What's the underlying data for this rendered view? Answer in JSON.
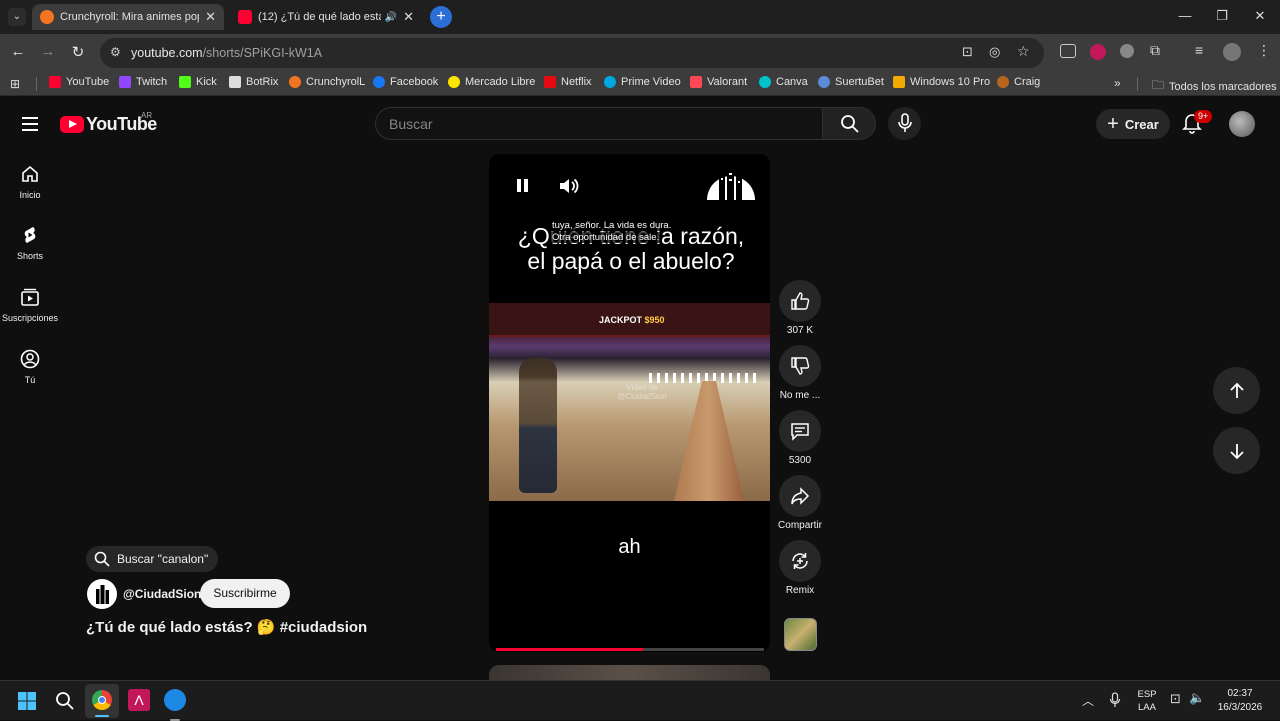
{
  "browser": {
    "tabs": [
      {
        "title": "Crunchyroll: Mira animes popul",
        "active": true
      },
      {
        "title": "(12) ¿Tú de qué lado estás?",
        "active": false
      }
    ],
    "url_host": "youtube.com",
    "url_path": "/shorts/SPiKGI-kW1A",
    "bookmarks": [
      "YouTube",
      "Twitch",
      "Kick",
      "BotRix",
      "CrunchyrolL",
      "Facebook",
      "Mercado Libre",
      "Netflix",
      "Prime Video",
      "Valorant",
      "Canva",
      "SuertuBet",
      "Windows 10 Pro",
      "Craig"
    ],
    "all_bookmarks": "Todos los marcadores",
    "bookmark_colors": [
      "#ff0033",
      "#9146ff",
      "#53fc18",
      "#dddddd",
      "#f47521",
      "#1877f2",
      "#ffe600",
      "#e50914",
      "#00a8e1",
      "#ff4655",
      "#00c4cc",
      "#5b8bd6",
      "#f2a900",
      "#b5651d"
    ]
  },
  "youtube": {
    "logo_text": "YouTube",
    "country": "AR",
    "search_placeholder": "Buscar",
    "create_label": "Crear",
    "notifications_badge": "9+",
    "sidebar": [
      {
        "label": "Inicio",
        "icon": "home-icon"
      },
      {
        "label": "Shorts",
        "icon": "shorts-icon"
      },
      {
        "label": "Suscripciones",
        "icon": "subscriptions-icon"
      },
      {
        "label": "Tú",
        "icon": "user-icon"
      }
    ],
    "short": {
      "overlay_question": "¿Quién tiene la razón, el papá o el abuelo?",
      "subtitle_line1": "tuya, señor. La vida es dura.",
      "subtitle_line2": "Otra oportunidad de sale.",
      "watermark": "Video de @CiudadSion",
      "caption": "ah",
      "progress": 0.55
    },
    "actions": {
      "likes": "307 K",
      "dislike": "No me ...",
      "comments": "5300",
      "share": "Compartir",
      "remix": "Remix"
    },
    "search_suggestion": "Buscar \"canalon\"",
    "channel": "@CiudadSion",
    "subscribe": "Suscribirme",
    "video_title": "¿Tú de qué lado estás? 🤔 #ciudadsion",
    "accent": "#ff0033"
  },
  "taskbar": {
    "lang1": "ESP",
    "lang2": "LAA",
    "time": "02:37",
    "date": "16/3/2026"
  }
}
